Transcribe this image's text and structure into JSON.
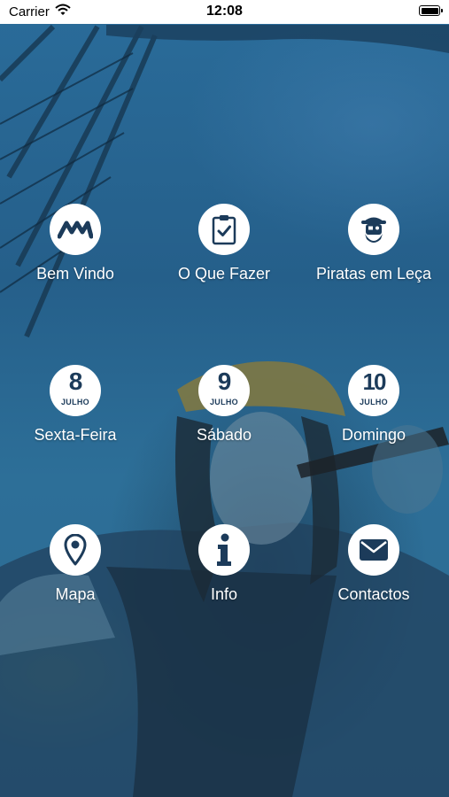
{
  "status_bar": {
    "carrier": "Carrier",
    "time": "12:08"
  },
  "menu": {
    "bem_vindo": {
      "label": "Bem Vindo",
      "icon": "mm-logo-icon"
    },
    "o_que_fazer": {
      "label": "O Que Fazer",
      "icon": "clipboard-check-icon"
    },
    "piratas": {
      "label": "Piratas em Leça",
      "icon": "pirate-head-icon"
    },
    "sexta": {
      "label": "Sexta-Feira",
      "day": "8",
      "month": "JULHO"
    },
    "sabado": {
      "label": "Sábado",
      "day": "9",
      "month": "JULHO"
    },
    "domingo": {
      "label": "Domingo",
      "day": "10",
      "month": "JULHO"
    },
    "mapa": {
      "label": "Mapa",
      "icon": "map-pin-icon"
    },
    "info": {
      "label": "Info",
      "icon": "info-icon"
    },
    "contactos": {
      "label": "Contactos",
      "icon": "envelope-icon"
    }
  },
  "colors": {
    "icon": "#1c3b5a",
    "label": "#ffffff",
    "background": "#2a6c9a"
  }
}
